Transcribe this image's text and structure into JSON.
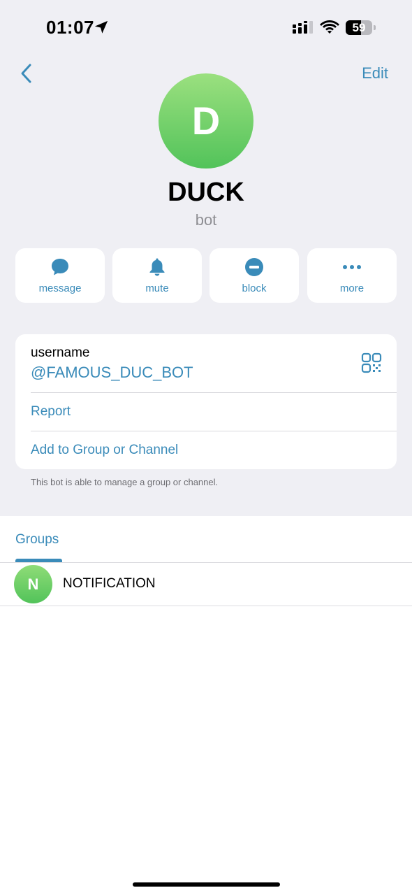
{
  "status_bar": {
    "time": "01:07",
    "battery_level": "59",
    "battery_fraction": 0.59
  },
  "nav": {
    "edit_label": "Edit"
  },
  "profile": {
    "avatar_initial": "D",
    "name": "DUCK",
    "subtitle": "bot",
    "avatar_colors": [
      "#9be07f",
      "#52c35a"
    ]
  },
  "actions": [
    {
      "label": "message",
      "icon": "chat-bubble-icon"
    },
    {
      "label": "mute",
      "icon": "bell-icon"
    },
    {
      "label": "block",
      "icon": "block-icon"
    },
    {
      "label": "more",
      "icon": "more-dots-icon"
    }
  ],
  "info": {
    "username_label": "username",
    "username_value": "@FAMOUS_DUC_BOT",
    "report_label": "Report",
    "add_label": "Add to Group or Channel",
    "footer_note": "This bot is able to manage a group or channel."
  },
  "groups": {
    "tab_label": "Groups",
    "items": [
      {
        "initial": "N",
        "name": "NOTIFICATION"
      }
    ]
  },
  "colors": {
    "accent": "#3a8bb9",
    "background": "#efeff4"
  }
}
